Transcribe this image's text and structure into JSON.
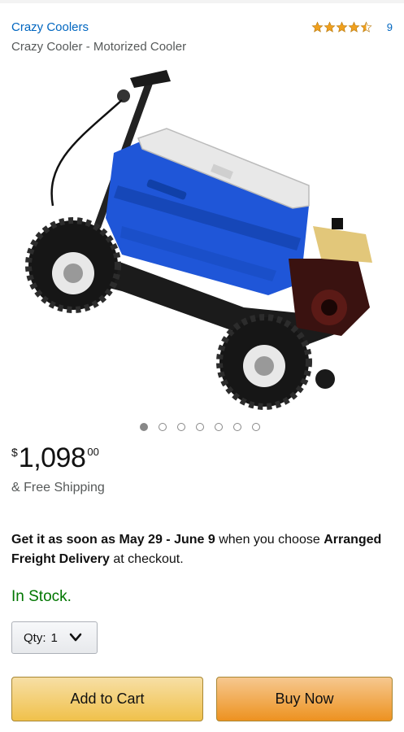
{
  "header": {
    "brand": "Crazy Coolers",
    "title": "Crazy Cooler - Motorized Cooler",
    "rating_stars": 4.5,
    "rating_count": "9"
  },
  "gallery": {
    "image_count": 7,
    "active_index": 0,
    "image_icon": "motorized-cooler-scooter"
  },
  "price": {
    "symbol": "$",
    "whole": "1,098",
    "fraction": "00"
  },
  "shipping": "& Free Shipping",
  "delivery": {
    "prefix": "Get it as soon as ",
    "dates": "May 29 - June 9",
    "middle": " when you choose ",
    "method": "Arranged Freight Delivery",
    "suffix": " at checkout."
  },
  "stock": "In Stock.",
  "quantity": {
    "label": "Qty:",
    "value": "1"
  },
  "actions": {
    "add_to_cart": "Add to Cart",
    "buy_now": "Buy Now"
  },
  "colors": {
    "link": "#0066c0",
    "stock": "#007600",
    "cart": "#f0c14b",
    "buy": "#ed9220"
  }
}
